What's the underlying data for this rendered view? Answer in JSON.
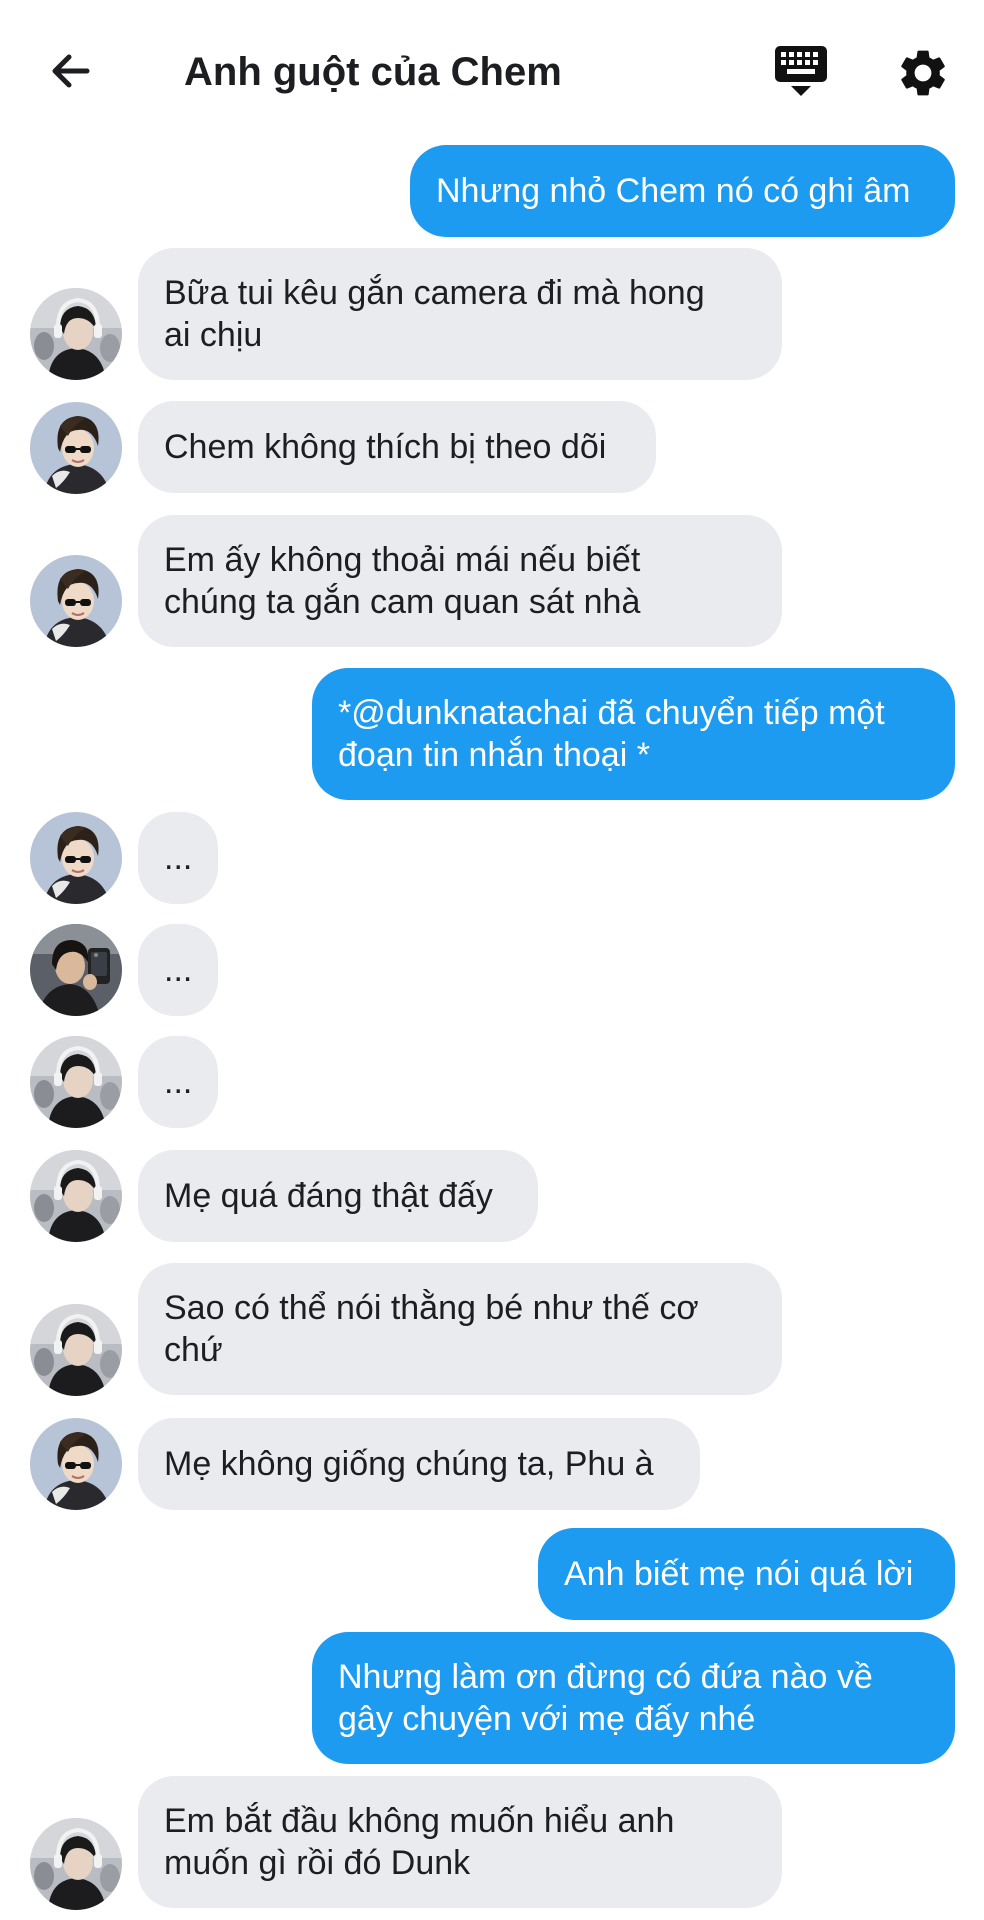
{
  "header": {
    "title": "Anh guột của Chem",
    "back_icon": "arrow-left-icon",
    "keyboard_icon": "keyboard-icon",
    "settings_icon": "gear-icon"
  },
  "colors": {
    "outgoing_bubble": "#1d9bf0",
    "incoming_bubble": "#e9ebef",
    "text": "#1c1e21"
  },
  "messages": [
    {
      "direction": "out",
      "text": "Nhưng nhỏ Chem nó có ghi âm"
    },
    {
      "direction": "in",
      "avatar": "headphones-boy",
      "text": "Bữa tui kêu gắn camera đi mà hong\nai chịu"
    },
    {
      "direction": "in",
      "avatar": "sunglasses-boy",
      "text": "Chem không thích bị theo dõi"
    },
    {
      "direction": "in",
      "avatar": "sunglasses-boy",
      "text": "Em ấy không thoải mái nếu biết\nchúng ta gắn cam quan sát nhà"
    },
    {
      "direction": "out",
      "text": "*@dunknatachai đã chuyển tiếp một\nđoạn tin nhắn thoại *"
    },
    {
      "direction": "in",
      "avatar": "sunglasses-boy",
      "text": "..."
    },
    {
      "direction": "in",
      "avatar": "mirror-selfie-boy",
      "text": "..."
    },
    {
      "direction": "in",
      "avatar": "headphones-boy",
      "text": "..."
    },
    {
      "direction": "in",
      "avatar": "headphones-boy",
      "text": "Mẹ quá đáng thật đấy"
    },
    {
      "direction": "in",
      "avatar": "headphones-boy",
      "text": "Sao có thể nói thằng bé như thế cơ\nchứ"
    },
    {
      "direction": "in",
      "avatar": "sunglasses-boy",
      "text": "Mẹ không giống chúng ta, Phu à"
    },
    {
      "direction": "out",
      "text": "Anh biết mẹ nói quá lời"
    },
    {
      "direction": "out",
      "text": "Nhưng làm ơn đừng có đứa nào về\ngây chuyện với mẹ đấy nhé"
    },
    {
      "direction": "in",
      "avatar": "headphones-boy",
      "text": "Em bắt đầu không muốn hiểu anh\nmuốn gì rồi đó Dunk"
    }
  ]
}
